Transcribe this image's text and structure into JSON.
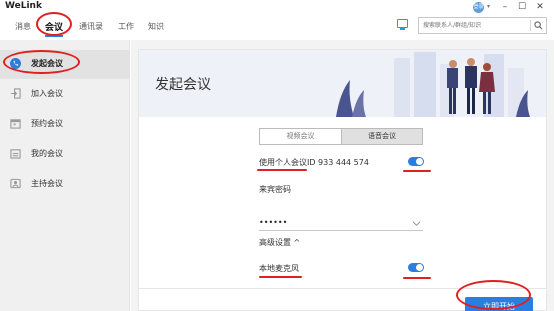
{
  "app": {
    "title": "WeLink",
    "avatar_text": "登录"
  },
  "nav": {
    "tabs": [
      {
        "label": "消息"
      },
      {
        "label": "会议"
      },
      {
        "label": "通讯录"
      },
      {
        "label": "工作"
      },
      {
        "label": "知识"
      }
    ],
    "active_tab": "会议"
  },
  "search": {
    "placeholder": "搜索联系人/群组/知识"
  },
  "sidebar": {
    "items": [
      {
        "label": "发起会议",
        "icon": "phone-icon"
      },
      {
        "label": "加入会议",
        "icon": "join-icon"
      },
      {
        "label": "预约会议",
        "icon": "calendar-icon"
      },
      {
        "label": "我的会议",
        "icon": "my-meetings-icon"
      },
      {
        "label": "主持会议",
        "icon": "host-icon"
      }
    ],
    "active_index": 0
  },
  "main": {
    "title": "发起会议",
    "mode_tabs": [
      {
        "label": "视频会议"
      },
      {
        "label": "语音会议"
      }
    ],
    "selected_mode": "语音会议",
    "personal_id_label": "使用个人会议ID 933 444 574",
    "personal_id_enabled": true,
    "password_label": "来宾密码",
    "password_value": "••••••",
    "advanced_label": "高级设置 ^",
    "mic_label": "本地麦克风",
    "mic_enabled": true,
    "start_button": "立即开始"
  },
  "colors": {
    "accent": "#2a7de1",
    "annotation": "#e02020",
    "sidebar_bg": "#f0f0f0",
    "banner_bg": "#eef1f8"
  }
}
